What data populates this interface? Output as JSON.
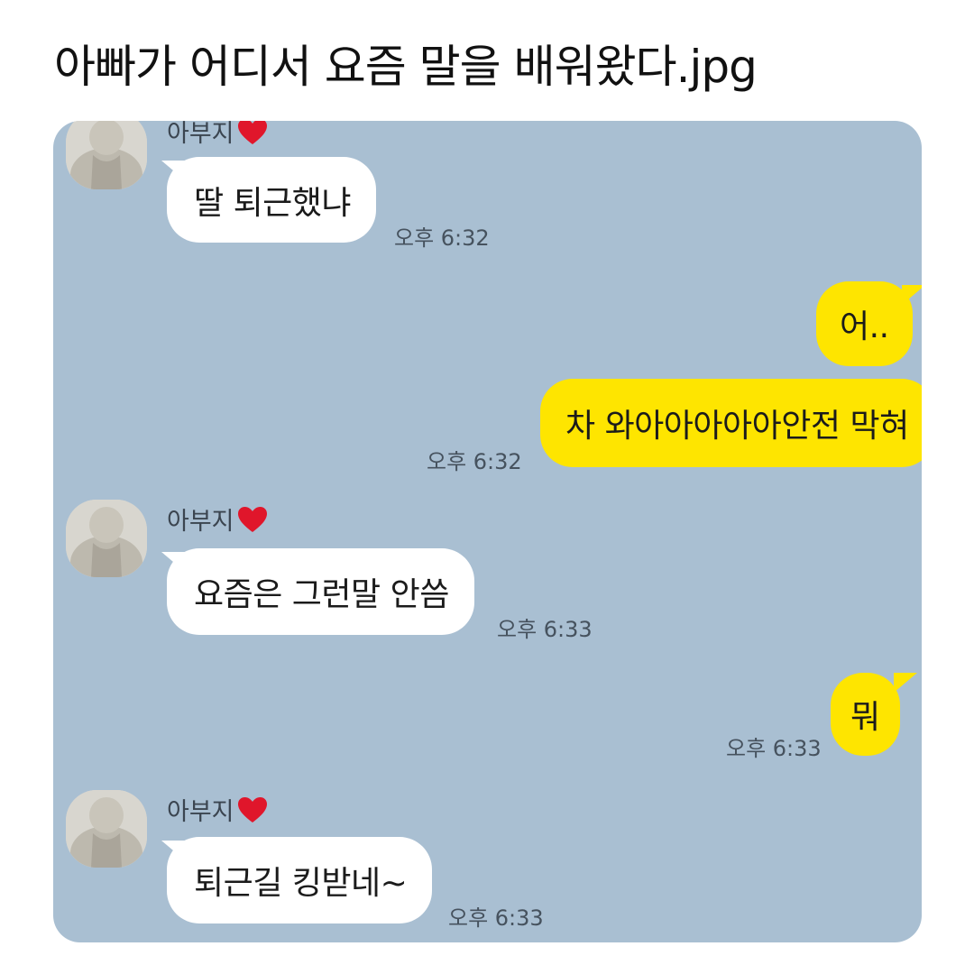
{
  "post": {
    "title": "아빠가 어디서 요즘 말을 배워왔다.jpg"
  },
  "chat": {
    "colors": {
      "background": "#a9bfd2",
      "incoming_bubble": "#ffffff",
      "outgoing_bubble": "#fee500"
    },
    "sender_name": "아부지",
    "sender_icon": "red-heart-icon",
    "messages": [
      {
        "from": "아부지",
        "text": "딸 퇴근했냐",
        "time": "오후 6:32"
      },
      {
        "from": "me",
        "text": "어..",
        "time": ""
      },
      {
        "from": "me",
        "text": "차 와아아아아아안전 막혀",
        "time": "오후 6:32"
      },
      {
        "from": "아부지",
        "text": "요즘은 그런말 안씀",
        "time": "오후 6:33"
      },
      {
        "from": "me",
        "text": "뭐",
        "time": "오후 6:33"
      },
      {
        "from": "아부지",
        "text": "퇴근길 킹받네~",
        "time": "오후 6:33"
      }
    ]
  }
}
